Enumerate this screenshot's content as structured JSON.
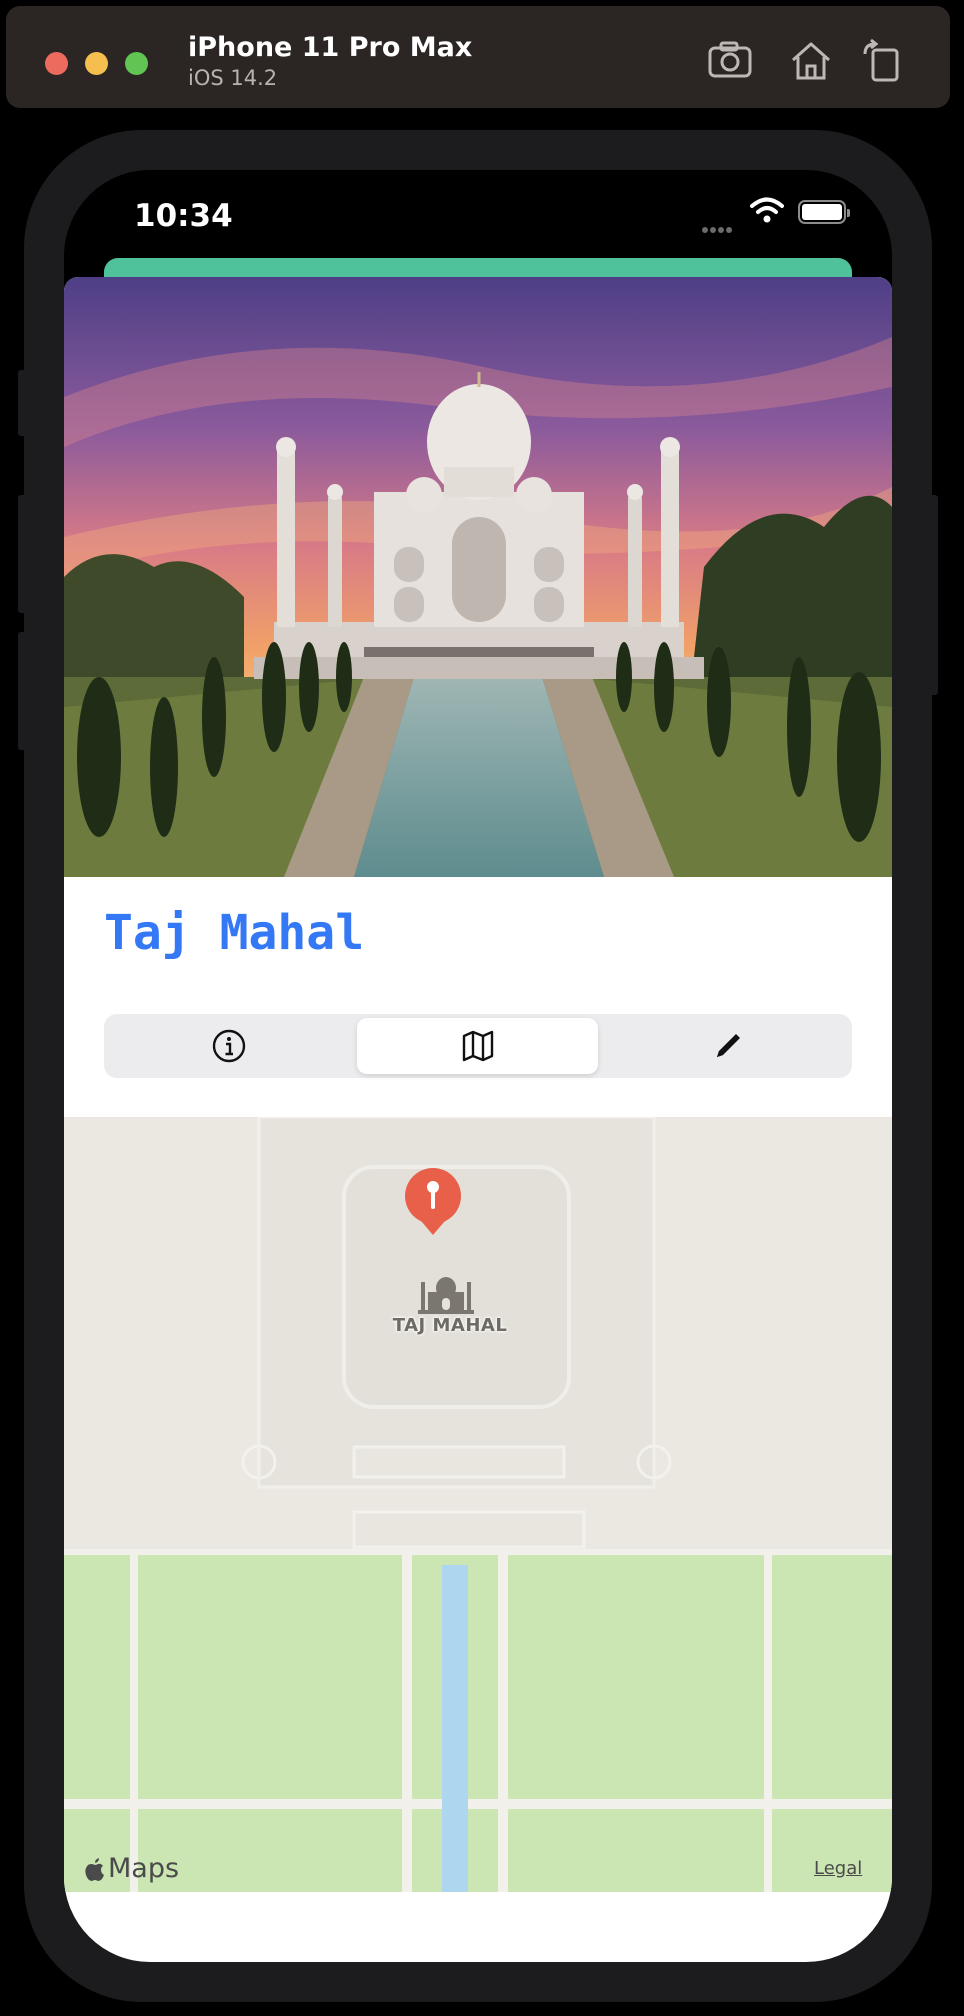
{
  "simulator": {
    "device_name": "iPhone 11 Pro Max",
    "os_version": "iOS 14.2",
    "toolbar_icons": [
      "screenshot-icon",
      "home-icon",
      "rotate-icon"
    ]
  },
  "status_bar": {
    "time": "10:34",
    "icons": [
      "signal-dots-icon",
      "wifi-icon",
      "battery-icon"
    ]
  },
  "place": {
    "title": "Taj Mahal",
    "hero_image": "taj-mahal-photo"
  },
  "segments": {
    "items": [
      {
        "icon": "info-circle-icon",
        "selected": false
      },
      {
        "icon": "map-icon",
        "selected": true
      },
      {
        "icon": "pencil-icon",
        "selected": false
      }
    ]
  },
  "map": {
    "poi_label": "TAJ MAHAL",
    "brand": "Maps",
    "legal": "Legal"
  },
  "colors": {
    "title": "#3478f6",
    "sheet_accent": "#4fc29b",
    "pin": "#e8604a",
    "park": "#cbe6b2",
    "water": "#aed6ee"
  }
}
